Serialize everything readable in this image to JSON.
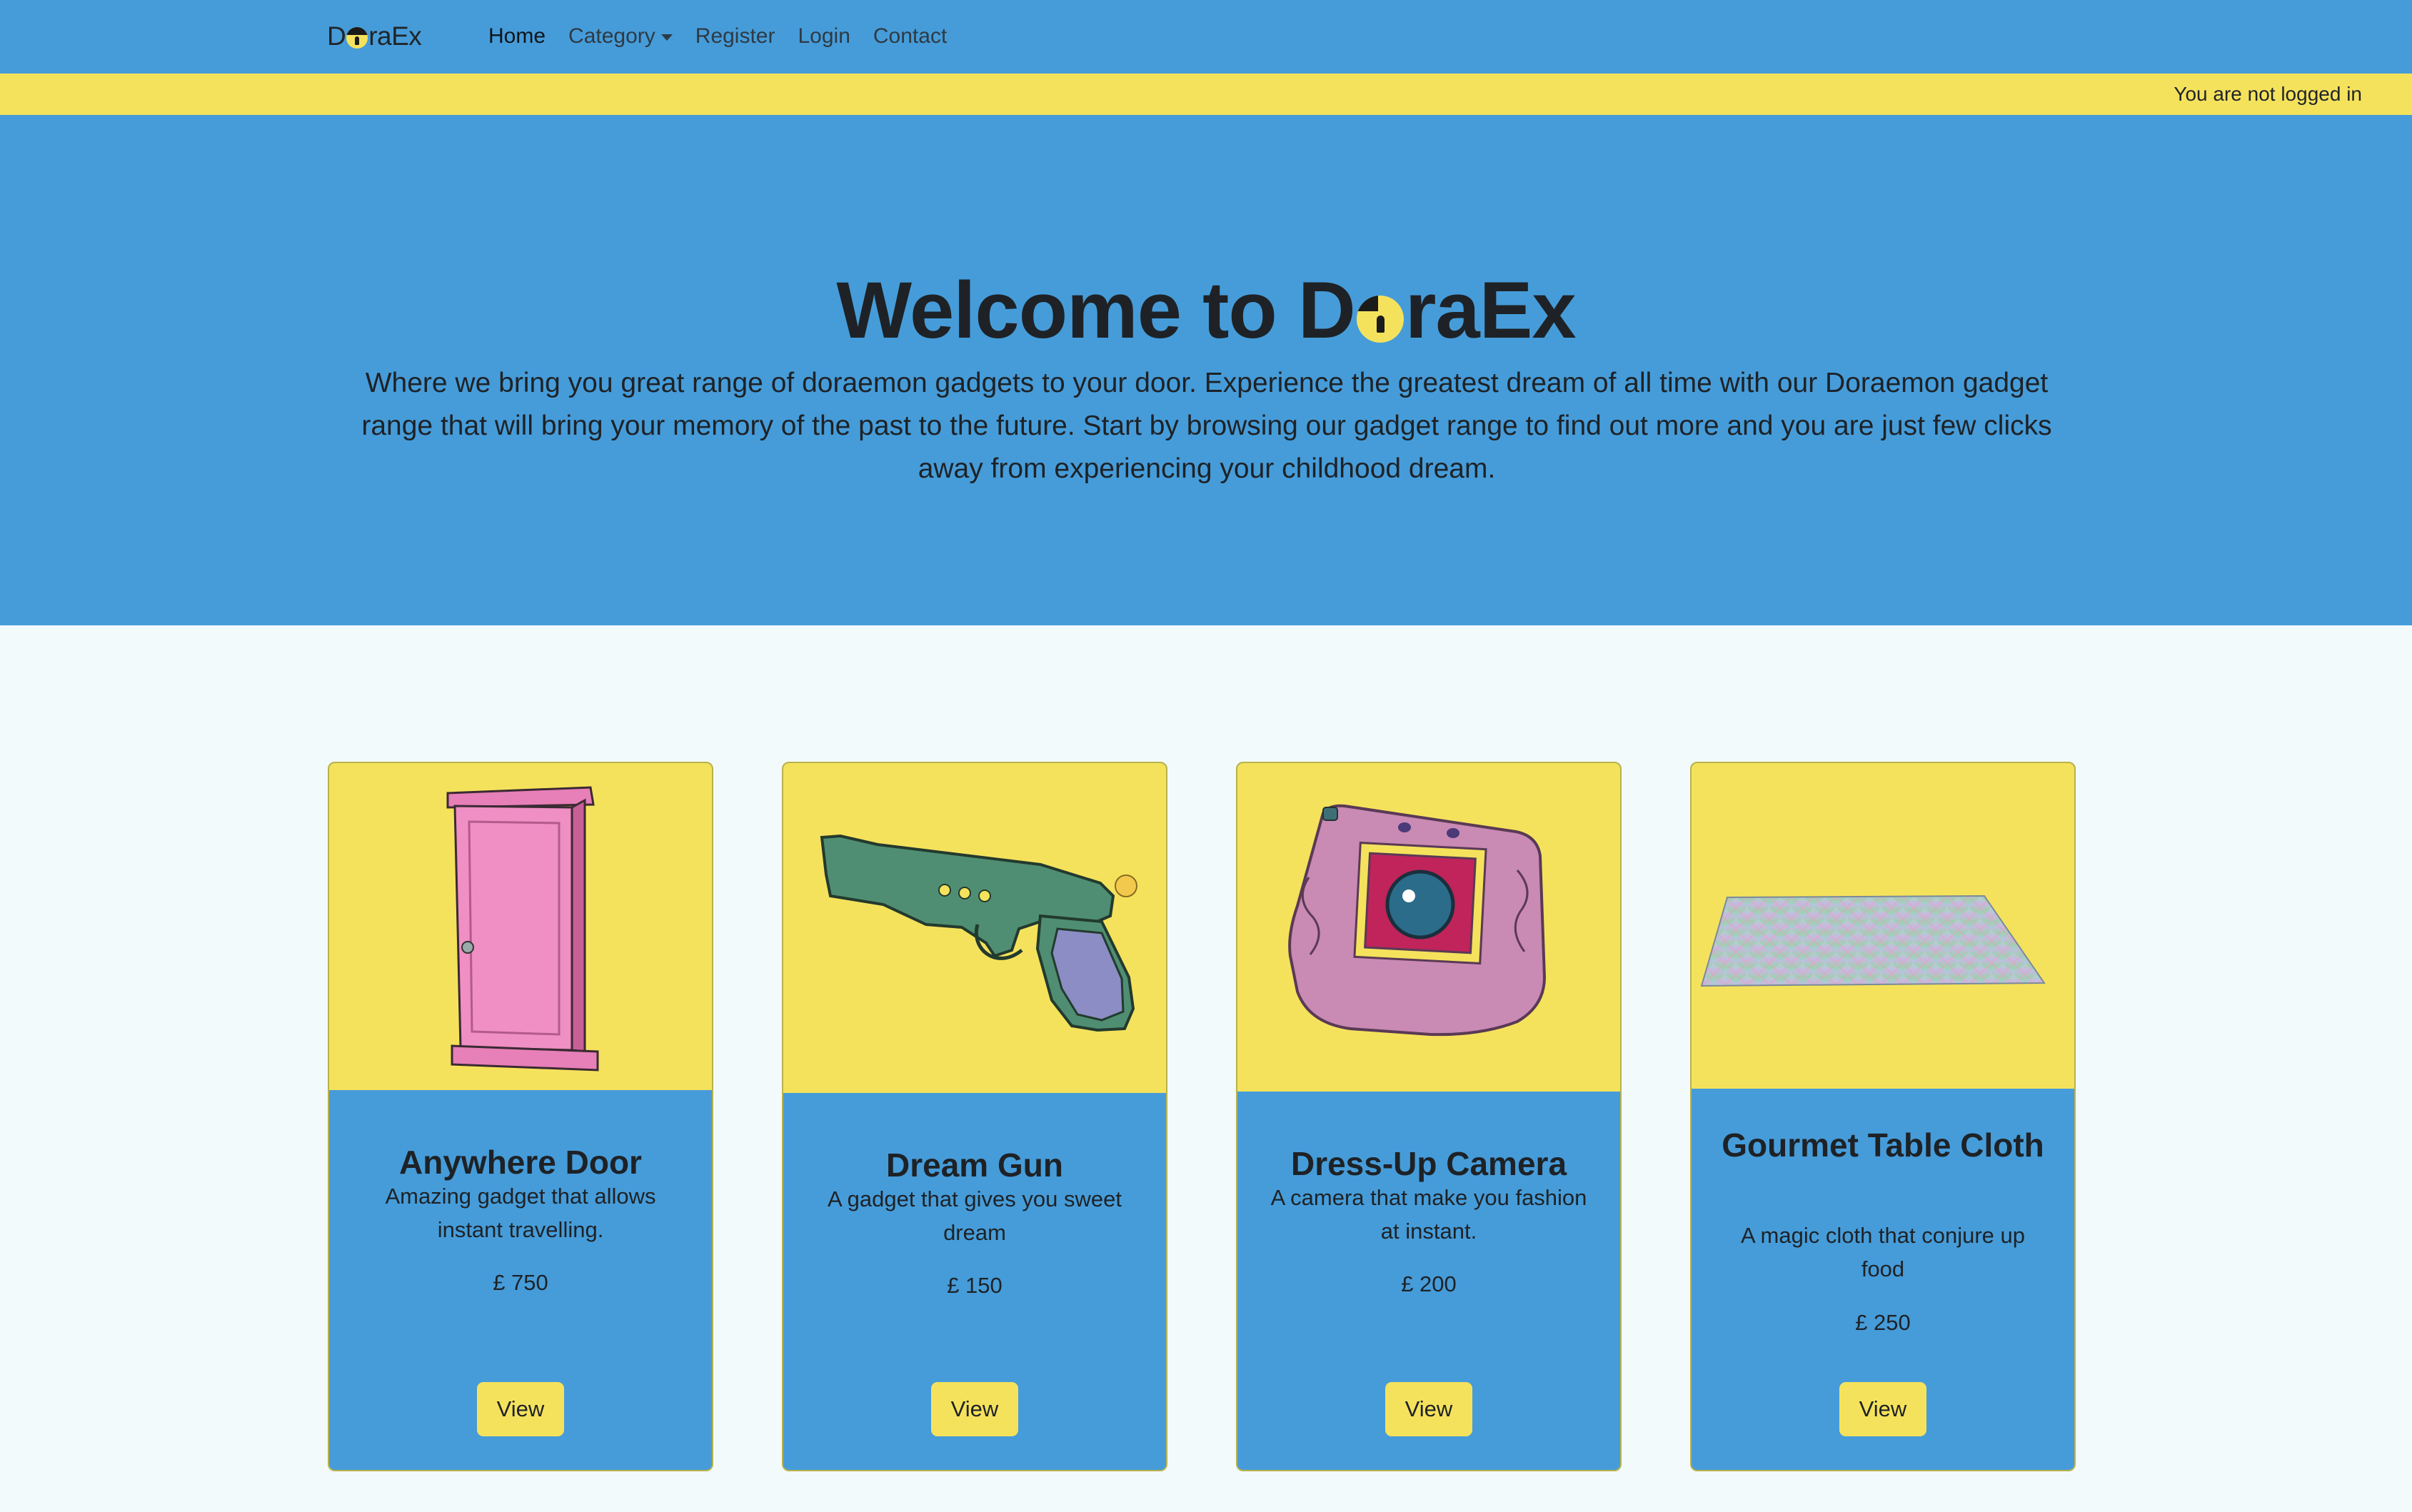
{
  "navbar": {
    "brand_prefix": "D",
    "brand_suffix": "raEx",
    "items": [
      {
        "label": "Home"
      },
      {
        "label": "Category"
      },
      {
        "label": "Register"
      },
      {
        "label": "Login"
      },
      {
        "label": "Contact"
      }
    ]
  },
  "status": {
    "text": "You are not logged in"
  },
  "hero": {
    "title_prefix": "Welcome to D",
    "title_suffix": "raEx",
    "subtitle": "Where we bring you great range of doraemon gadgets to your door. Experience the greatest dream of all time with our Doraemon gadget range that will bring your memory of the past to the future. Start by browsing our gadget range to find out more and you are just few clicks away from experiencing your childhood dream."
  },
  "products": [
    {
      "name": "Anywhere Door",
      "description": "Amazing gadget that allows instant travelling.",
      "price": "£ 750",
      "button": "View",
      "icon": "anywhere-door-image"
    },
    {
      "name": "Dream Gun",
      "description": "A gadget that gives you sweet dream",
      "price": "£ 150",
      "button": "View",
      "icon": "dream-gun-image"
    },
    {
      "name": "Dress-Up Camera",
      "description": "A camera that make you fashion at instant.",
      "price": "£ 200",
      "button": "View",
      "icon": "dress-up-camera-image"
    },
    {
      "name": "Gourmet Table Cloth",
      "description": "A magic cloth that conjure up food",
      "price": "£ 250",
      "button": "View",
      "icon": "table-cloth-image"
    }
  ],
  "colors": {
    "primary_blue": "#469cd9",
    "accent_yellow": "#f5e25c",
    "page_background": "#f2fafb"
  }
}
